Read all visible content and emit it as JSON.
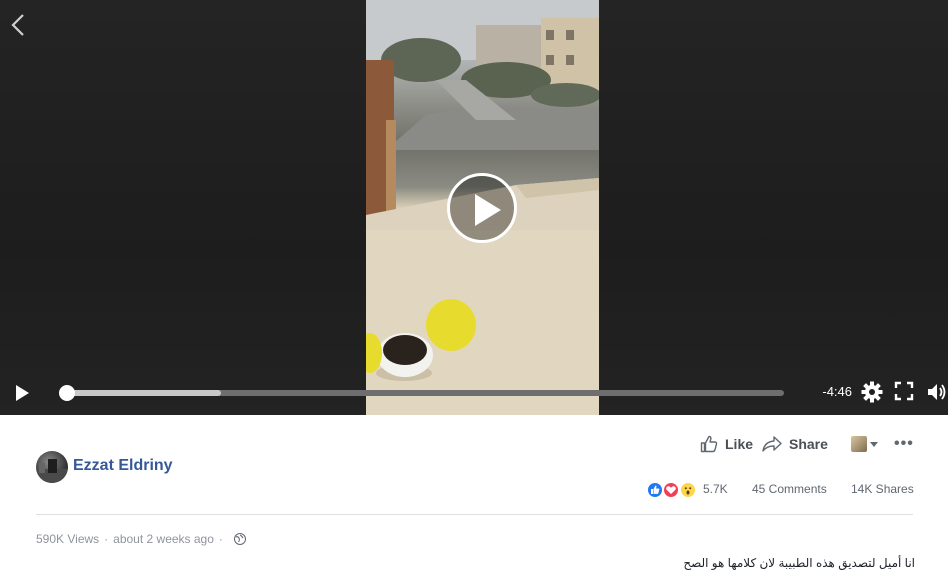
{
  "player": {
    "time_remaining": "-4:46",
    "progress_fraction": 0.0,
    "buffered_fraction": 0.215
  },
  "post": {
    "author": "Ezzat Eldriny",
    "like_label": "Like",
    "share_label": "Share",
    "more_label": "•••",
    "reaction_count": "5.7K",
    "comments_label": "45 Comments",
    "shares_label": "14K Shares",
    "views": "590K Views",
    "separator": "·",
    "posted_time": "about 2 weeks ago",
    "caption": "انا أميل لتصديق هذه الطبيبة لان كلامها هو الصح"
  },
  "icons": {
    "back": "chevron-left-icon",
    "play": "play-icon",
    "settings": "gear-icon",
    "fullscreen": "fullscreen-icon",
    "volume": "volume-icon",
    "like": "thumbs-up-icon",
    "share": "share-arrow-icon",
    "privacy": "globe-icon"
  },
  "colors": {
    "link": "#365899",
    "meta": "#90949c"
  }
}
